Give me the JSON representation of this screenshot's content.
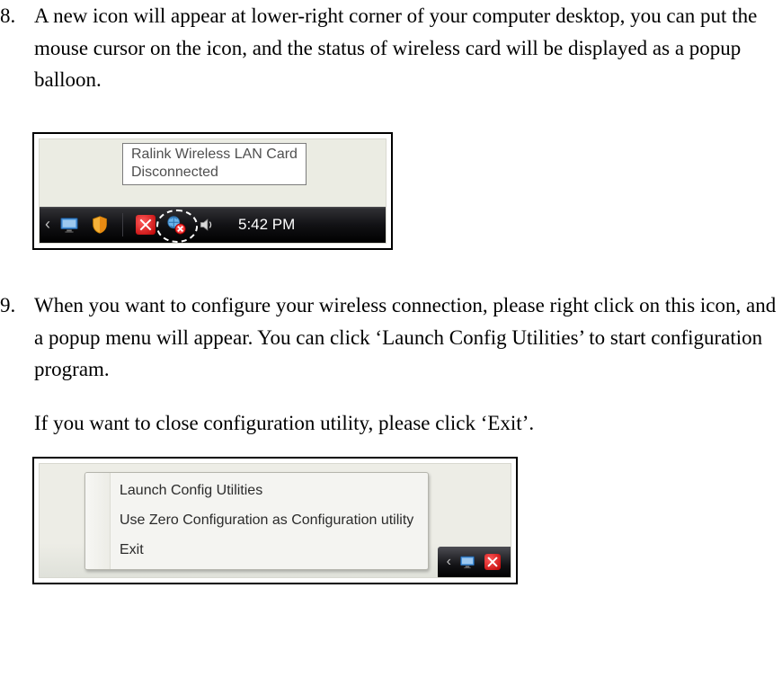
{
  "steps": {
    "s8": {
      "num": "8.",
      "text": "A new icon will appear at lower-right corner of your computer desktop, you can put the mouse cursor on the icon, and the status of wireless card will be displayed as a popup balloon."
    },
    "s9": {
      "num": "9.",
      "text_a": "When you want to configure your wireless connection, please right click on this icon, and a popup menu will appear. You can click ‘Launch Config Utilities’ to start configuration program.",
      "text_b": "If you want to close configuration utility, please click ‘Exit’."
    }
  },
  "tray": {
    "tooltip_line1": "Ralink Wireless LAN Card",
    "tooltip_line2": "Disconnected",
    "clock": "5:42 PM"
  },
  "menu": {
    "items": [
      "Launch Config Utilities",
      "Use Zero Configuration as Configuration utility",
      "Exit"
    ]
  }
}
